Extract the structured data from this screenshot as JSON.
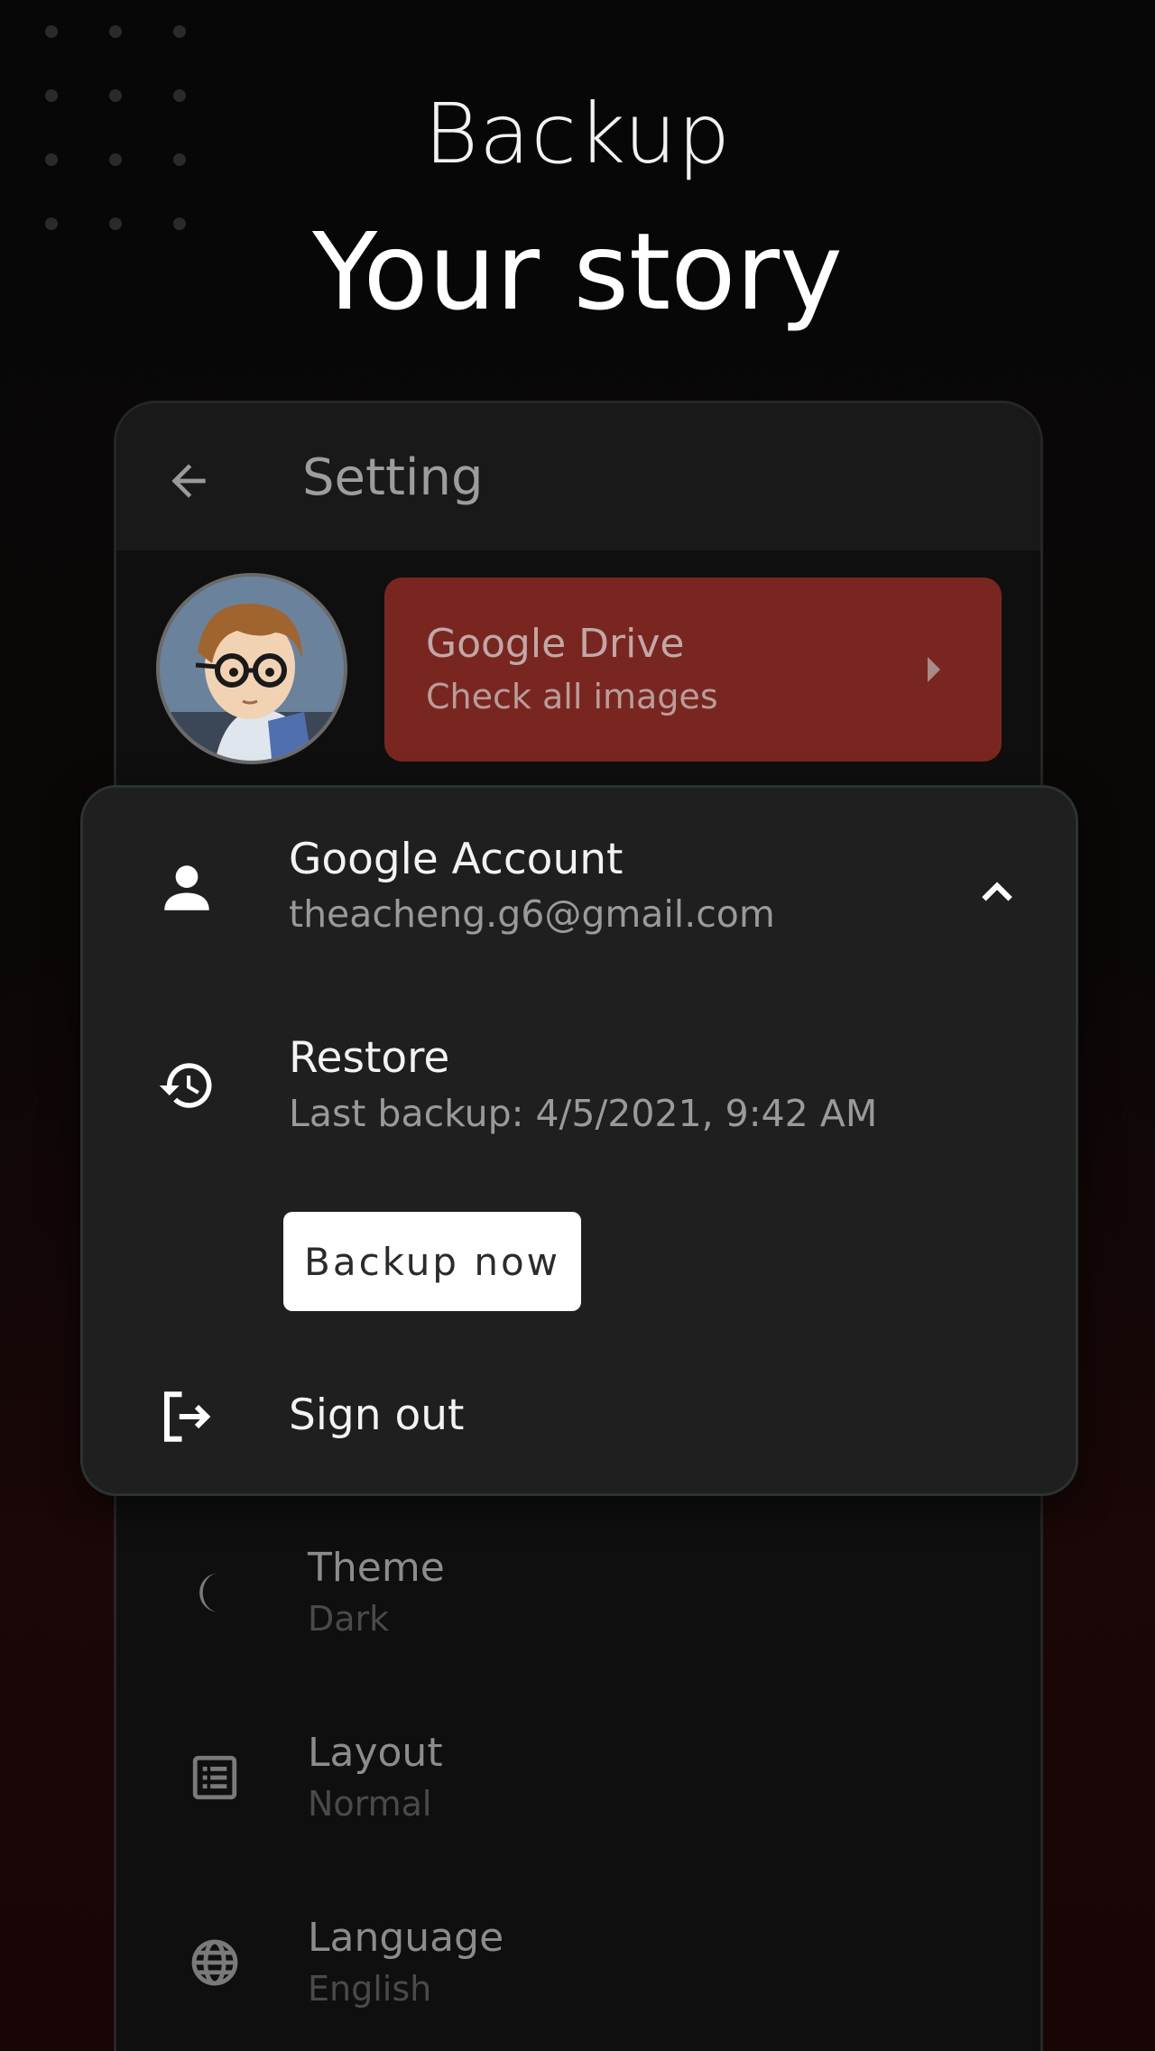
{
  "hero": {
    "subtitle": "Backup",
    "title": "Your story"
  },
  "appbar": {
    "title": "Setting",
    "back_icon": "arrow-left-icon"
  },
  "drive_card": {
    "title": "Google Drive",
    "subtitle": "Check all images",
    "color": "#7a2620"
  },
  "account_menu": {
    "account_title": "Google Account",
    "account_email": "theacheng.g6@gmail.com",
    "restore_title": "Restore",
    "restore_sub": "Last backup: 4/5/2021, 9:42 AM",
    "backup_button": "Backup now",
    "sign_out": "Sign out"
  },
  "settings": [
    {
      "title": "Theme",
      "value": "Dark",
      "icon": "moon-icon"
    },
    {
      "title": "Layout",
      "value": "Normal",
      "icon": "list-icon"
    },
    {
      "title": "Language",
      "value": "English",
      "icon": "globe-icon"
    }
  ],
  "colors": {
    "accent": "#7a2620",
    "menu_bg": "#1f1f1f",
    "background": "#0f0f0f"
  }
}
